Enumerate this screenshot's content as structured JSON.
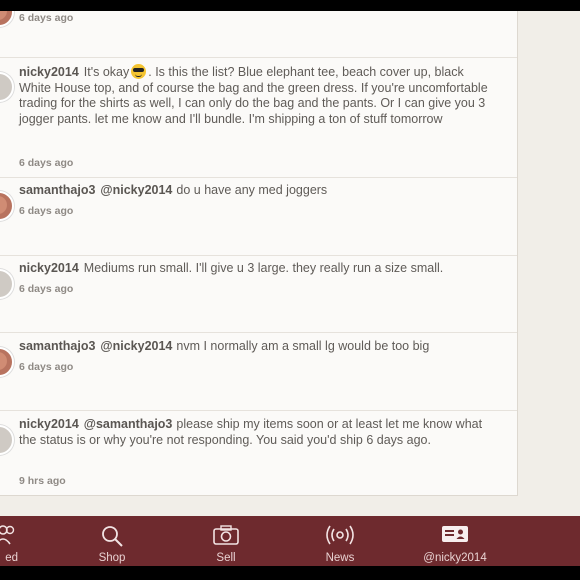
{
  "comments": [
    {
      "user": "",
      "mention": "",
      "text": "",
      "time": "6 days ago"
    },
    {
      "user": "nicky2014",
      "mention": "",
      "text_before_emoji": "It's okay",
      "text": ". Is this the list? Blue elephant tee, beach cover up, black White House top, and of course the bag and the green dress. If you're uncomfortable trading for the shirts as well, I can only do the bag and the pants. Or I can give you 3 jogger pants. let me know and I'll bundle. I'm shipping a ton of stuff tomorrow",
      "time": "6 days ago"
    },
    {
      "user": "samanthajo3",
      "mention": "@nicky2014",
      "text": "do u have any med joggers",
      "time": "6 days ago"
    },
    {
      "user": "nicky2014",
      "mention": "",
      "text": "Mediums run small. I'll give u 3 large. they really run a size small.",
      "time": "6 days ago"
    },
    {
      "user": "samanthajo3",
      "mention": "@nicky2014",
      "text": "nvm I normally am a small lg would be too big",
      "time": "6 days ago"
    },
    {
      "user": "nicky2014",
      "mention": "@samanthajo3",
      "text": "please ship my items soon or at least let me know what the status is or why you're not responding. You said you'd ship 6 days ago.",
      "time": "9 hrs ago"
    }
  ],
  "tabs": [
    {
      "label": "ed",
      "icon": "people-icon"
    },
    {
      "label": "Shop",
      "icon": "search-icon"
    },
    {
      "label": "Sell",
      "icon": "camera-icon"
    },
    {
      "label": "News",
      "icon": "broadcast-icon"
    },
    {
      "label": "@nicky2014",
      "icon": "profile-card-icon"
    }
  ],
  "colors": {
    "tabbar": "#6e2a2e",
    "background": "#f1eee8"
  }
}
